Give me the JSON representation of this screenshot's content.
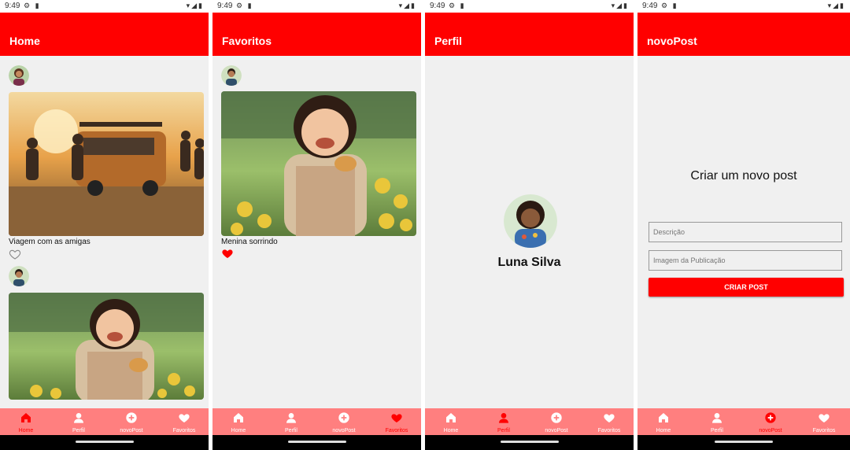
{
  "status": {
    "time": "9:49"
  },
  "colors": {
    "primary": "#ff0000",
    "nav_bg": "#ff7f7f",
    "page_bg": "#f0f0f0",
    "heart_active": "#ff0000",
    "heart_inactive": "#888888"
  },
  "nav_items": [
    "Home",
    "Perfil",
    "novoPost",
    "Favoritos"
  ],
  "screens": [
    {
      "title": "Home",
      "active_tab": "Home",
      "posts": [
        {
          "caption": "Viagem com as amigas",
          "favorited": false,
          "image": "friends-van-sunset"
        },
        {
          "caption": "",
          "favorited": false,
          "image": "girl-with-ducklings"
        }
      ]
    },
    {
      "title": "Favoritos",
      "active_tab": "Favoritos",
      "posts": [
        {
          "caption": "Menina sorrindo",
          "favorited": true,
          "image": "girl-with-ducklings"
        }
      ]
    },
    {
      "title": "Perfil",
      "active_tab": "Perfil",
      "profile": {
        "name": "Luna Silva"
      }
    },
    {
      "title": "novoPost",
      "active_tab": "novoPost",
      "form": {
        "heading": "Criar um novo post",
        "description_placeholder": "Descrição",
        "image_placeholder": "Imagem da Publicação",
        "submit_label": "CRIAR POST"
      }
    }
  ]
}
